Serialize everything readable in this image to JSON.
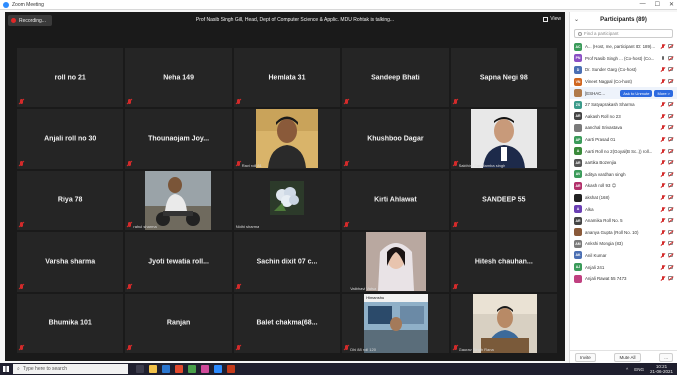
{
  "window": {
    "title": "Zoom Meeting"
  },
  "video": {
    "recording_label": "Recording...",
    "talking_text": "Prof Nasib Singh Gill, Head, Dept of Computer Science & Applic. MDU Rohtak is talking...",
    "view_label": "View"
  },
  "tiles": [
    {
      "name": "roll no 21"
    },
    {
      "name": "Neha 149"
    },
    {
      "name": "Hemlata 31"
    },
    {
      "name": "Sandeep Bhati"
    },
    {
      "name": "Sapna Negi 98"
    },
    {
      "name": "Anjali roll no 30"
    },
    {
      "name": "Thounaojam  Joy..."
    },
    {
      "caption": "Ravi roll 81"
    },
    {
      "name": "Khushboo Dagar"
    },
    {
      "caption": "Sakthim Sanatamba singh"
    },
    {
      "name": "Riya 78"
    },
    {
      "caption": "rahul sharma"
    },
    {
      "caption": "Nidhi sharma"
    },
    {
      "name": "Kirti Ahlawat"
    },
    {
      "name": "SANDEEP 55"
    },
    {
      "name": "Varsha sharma"
    },
    {
      "name": "Jyoti tewatia roll..."
    },
    {
      "name": "Sachin dixit 07 c..."
    },
    {
      "caption": "Vaibhavi Vatsa"
    },
    {
      "name": "Hitesh  chauhan..."
    },
    {
      "name": "Bhumika 101"
    },
    {
      "name": "Ranjan"
    },
    {
      "name": "Balet  chakma(68..."
    },
    {
      "caption": "Dhi 88 roll 120",
      "top_caption": "Himanshu"
    },
    {
      "caption": "Gaurav Singh Rana"
    }
  ],
  "panel": {
    "title": "Participants (89)",
    "search_placeholder": "Find a participant",
    "participants": [
      {
        "initials": "AC",
        "name": "A... (Host, me, participant ID: 189)...",
        "color": "#3b9b5a"
      },
      {
        "initials": "PN",
        "name": "Prof Nasib Singh ... (Co-host) (Co...",
        "color": "#8a4fc4"
      },
      {
        "initials": "D",
        "name": "Dr. Sunder Garg (Co-host)",
        "color": "#4b6fb3"
      },
      {
        "initials": "VN",
        "name": "Vineet Nagpal (Co-host)",
        "color": "#d0661f"
      },
      {
        "initials": "",
        "name": "[ESHAC...",
        "color": "#b07a4a",
        "btn1": "Ask to Unmute",
        "btn2": "More >"
      },
      {
        "initials": "ZS",
        "name": "27 Satyaprakash Sharma",
        "color": "#3b9b8a"
      },
      {
        "initials": "AR",
        "name": "Aakash Roll no 23",
        "color": "#444444"
      },
      {
        "initials": "",
        "name": "aanchal Srivastava",
        "color": "#7a7a7a"
      },
      {
        "initials": "AP",
        "name": "Aarti Prasad 01",
        "color": "#3b9b5a"
      },
      {
        "initials": "A",
        "name": "Aarti Roll no 2(Goyal(B Sc..)) roll...",
        "color": "#3a8a3a"
      },
      {
        "initials": "AR",
        "name": "aartika Bozenjia",
        "color": "#555555"
      },
      {
        "initials": "AV",
        "name": "aditya vardhan singh",
        "color": "#3b9b5a"
      },
      {
        "initials": "AR",
        "name": "Akash roll 93 😊",
        "color": "#b2306a"
      },
      {
        "initials": "",
        "name": "akshat (168)",
        "color": "#222222"
      },
      {
        "initials": "A",
        "name": "Alka",
        "color": "#6a3fb3"
      },
      {
        "initials": "AR",
        "name": "Anamika Roll No. 5",
        "color": "#444444"
      },
      {
        "initials": "",
        "name": "ananya Gupta (Roll No. 10)",
        "color": "#8a5a3a"
      },
      {
        "initials": "AM",
        "name": "Ankshi Mongia (83)",
        "color": "#7a7a7a"
      },
      {
        "initials": "AK",
        "name": "Anil Kumar",
        "color": "#4b6fb3"
      },
      {
        "initials": "AJ",
        "name": "Anjali 241",
        "color": "#3b9b5a"
      },
      {
        "initials": "",
        "name": "Anjali Rawat 55 7473",
        "color": "#c04080"
      }
    ],
    "invite_label": "Invite",
    "mute_all_label": "Mute All",
    "more_label": "..."
  },
  "taskbar": {
    "search_placeholder": "Type here to search",
    "lang": "ENG",
    "time": "10:21",
    "date": "21-06-2021"
  }
}
